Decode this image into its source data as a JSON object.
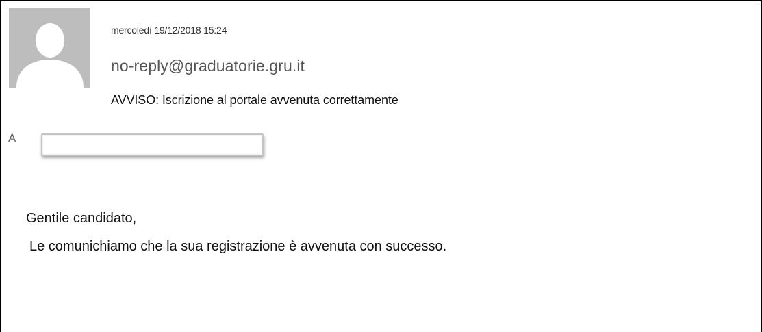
{
  "email": {
    "avatar_icon": "user-placeholder-icon",
    "date": "mercoledì 19/12/2018 15:24",
    "sender": "no-reply@graduatorie.gru.it",
    "subject": "AVVISO: Iscrizione al portale avvenuta correttamente",
    "to_label": "A",
    "to_value": "",
    "body": {
      "greeting": "Gentile candidato,",
      "message": "Le comunichiamo che la sua registrazione è avvenuta con successo."
    }
  },
  "colors": {
    "avatar_background": "#bdbdbd",
    "avatar_silhouette": "#ffffff",
    "frame_border": "#000000"
  }
}
